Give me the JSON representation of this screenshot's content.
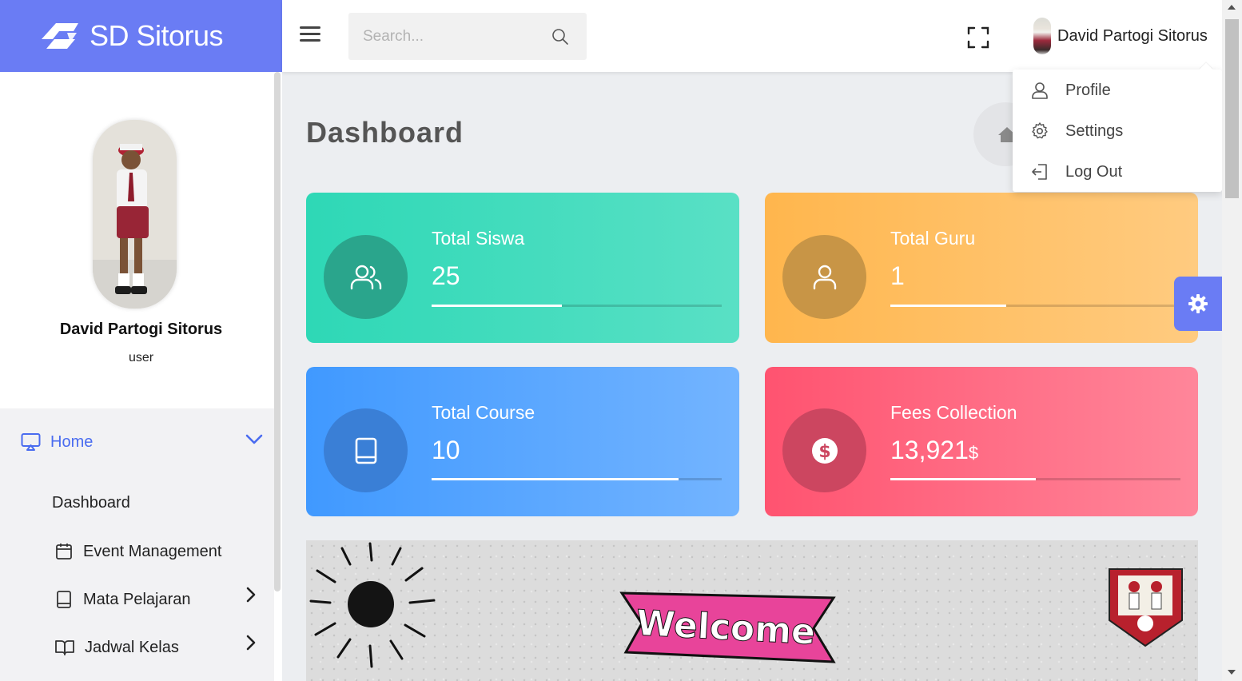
{
  "brand": {
    "name": "SD Sitorus"
  },
  "topbar": {
    "search_placeholder": "Search...",
    "user_name": "David Partogi Sitorus"
  },
  "sidebar": {
    "profile_name": "David Partogi Sitorus",
    "profile_role": "user",
    "nav": {
      "home": "Home",
      "dashboard": "Dashboard",
      "event": "Event Management",
      "mapel": "Mata Pelajaran",
      "jadwal": "Jadwal Kelas"
    }
  },
  "main": {
    "title": "Dashboard",
    "cards": [
      {
        "label": "Total Siswa",
        "value": "25",
        "progress": 0.45,
        "icon": "users-icon",
        "color": "#2ed8b6"
      },
      {
        "label": "Total Guru",
        "value": "1",
        "progress": 0.4,
        "icon": "user-icon",
        "color": "#ffb64d"
      },
      {
        "label": "Total Course",
        "value": "10",
        "progress": 0.85,
        "icon": "book-icon",
        "color": "#4099ff"
      },
      {
        "label": "Fees Collection",
        "value": "13,921",
        "unit": "$",
        "progress": 0.5,
        "icon": "dollar-icon",
        "color": "#ff5370"
      }
    ],
    "banner_text": "Welcome"
  },
  "dropdown": {
    "profile": "Profile",
    "settings": "Settings",
    "logout": "Log Out"
  },
  "colors": {
    "accent": "#6a7cf4",
    "nav_active": "#4a6cf0"
  }
}
